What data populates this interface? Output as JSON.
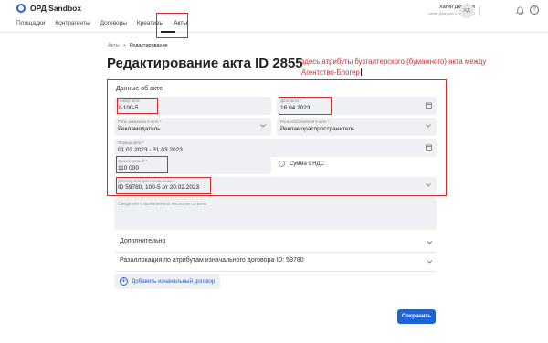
{
  "header": {
    "logo_text": "ОРД Sandbox",
    "nav": [
      "Площадки",
      "Контрагенты",
      "Договоры",
      "Креативы",
      "Акты"
    ],
    "user_name": "Хатин Дмитрий",
    "user_sub": "Хатин Дмитрий Степанович",
    "avatar_initials": "ХД"
  },
  "breadcrumb": {
    "root": "Акты",
    "separator": ">",
    "current": "Редактирование"
  },
  "page_title": "Редактирование акта ID 2855",
  "annotation": "здесь атрибуты бухгалтерского (бумажного) акта между Агентство-Блогер",
  "form": {
    "section_title": "Данные об акте",
    "act_number": {
      "label": "Номер акта",
      "value": "1-100-5"
    },
    "act_date": {
      "label": "Дата акта *",
      "value": "16.04.2023"
    },
    "customer_role": {
      "label": "Роль заказчика в акте *",
      "value": "Рекламодатель"
    },
    "executor_role": {
      "label": "Роль исполнителя в акте *",
      "value": "Рекламораспространитель"
    },
    "period": {
      "label": "Период акта *",
      "value": "01.03.2023 - 31.03.2023"
    },
    "amount": {
      "label": "Сумма акта, ₽ *",
      "value": "110 000"
    },
    "vat_label": "Сумма с НДС",
    "contract": {
      "label": "Договор или доп соглашение *",
      "value": "ID 59780, 100-5 от 20.02.2023"
    },
    "discrepancy_placeholder": "Сведения о выявленных несоответствиях"
  },
  "sections": {
    "additional": "Дополнительно",
    "reallocation": "Разаллокация по атрибутам изначального договора ID: 59780"
  },
  "add_contract_label": "Добавить изначальный договор",
  "save_label": "Сохранить",
  "colors": {
    "accent": "#1e64d9",
    "annotation": "#d42b2b",
    "field_bg": "#eef0f3"
  }
}
